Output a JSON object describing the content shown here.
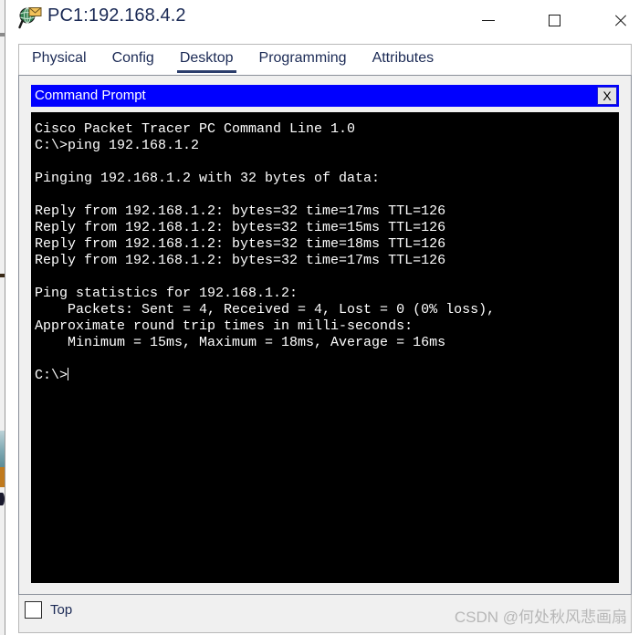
{
  "window": {
    "icon": "packet-tracer-pc-icon",
    "title": "PC1:192.168.4.2",
    "controls": {
      "minimize": "—",
      "maximize": "□",
      "close": "✕"
    }
  },
  "tabs": [
    {
      "label": "Physical",
      "active": false
    },
    {
      "label": "Config",
      "active": false
    },
    {
      "label": "Desktop",
      "active": true
    },
    {
      "label": "Programming",
      "active": false
    },
    {
      "label": "Attributes",
      "active": false
    }
  ],
  "command_prompt": {
    "title": "Command Prompt",
    "close_label": "X",
    "lines": [
      "Cisco Packet Tracer PC Command Line 1.0",
      "C:\\>ping 192.168.1.2",
      "",
      "Pinging 192.168.1.2 with 32 bytes of data:",
      "",
      "Reply from 192.168.1.2: bytes=32 time=17ms TTL=126",
      "Reply from 192.168.1.2: bytes=32 time=15ms TTL=126",
      "Reply from 192.168.1.2: bytes=32 time=18ms TTL=126",
      "Reply from 192.168.1.2: bytes=32 time=17ms TTL=126",
      "",
      "Ping statistics for 192.168.1.2:",
      "    Packets: Sent = 4, Received = 4, Lost = 0 (0% loss),",
      "Approximate round trip times in milli-seconds:",
      "    Minimum = 15ms, Maximum = 18ms, Average = 16ms",
      "",
      "C:\\>"
    ],
    "prompt_text": "C:\\>"
  },
  "bottom": {
    "checkbox_label": "Top",
    "checkbox_checked": false,
    "watermark": "CSDN @何处秋风悲画扇"
  },
  "colors": {
    "title_blue": "#1b2a55",
    "cmd_titlebar": "#0000ff",
    "terminal_bg": "#000000",
    "terminal_fg": "#ffffff",
    "panel_bg": "#f0f0f0",
    "tab_underline": "#2b3d6b"
  }
}
